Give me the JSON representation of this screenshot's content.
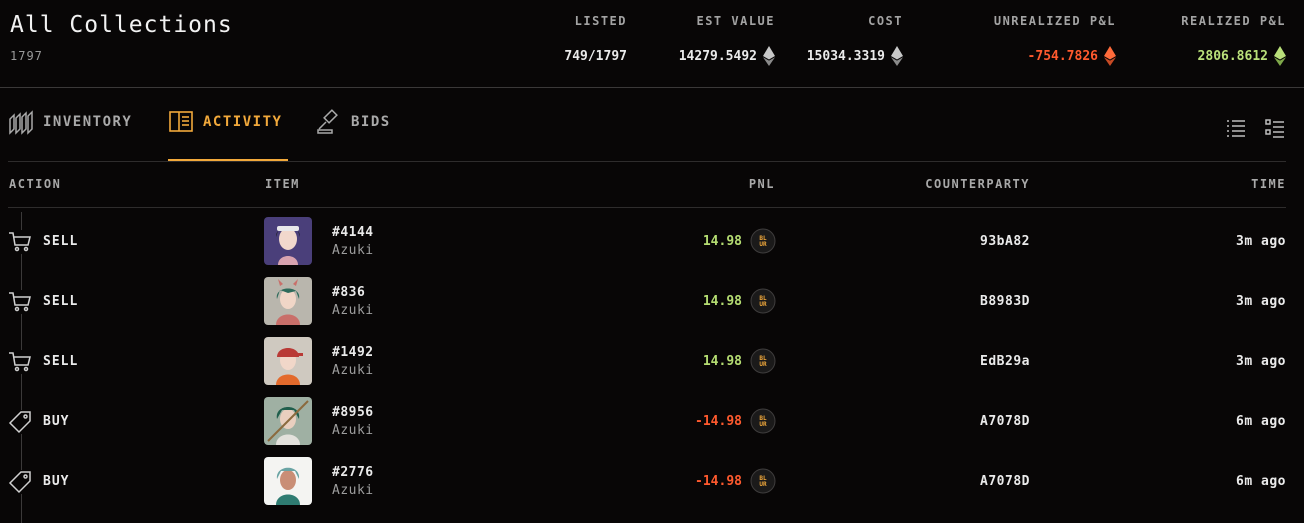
{
  "header": {
    "title": "All Collections",
    "count": "1797",
    "stats": {
      "listed": {
        "label": "LISTED",
        "value": "749/1797"
      },
      "est_value": {
        "label": "EST VALUE",
        "value": "14279.5492"
      },
      "cost": {
        "label": "COST",
        "value": "15034.3319"
      },
      "unrealized": {
        "label": "UNREALIZED P&L",
        "value": "-754.7826",
        "color": "#ff5a2e"
      },
      "realized": {
        "label": "REALIZED P&L",
        "value": "2806.8612",
        "color": "#b9e07a"
      }
    }
  },
  "tabs": [
    {
      "label": "INVENTORY",
      "icon": "inventory-icon",
      "active": false
    },
    {
      "label": "ACTIVITY",
      "icon": "book-icon",
      "active": true
    },
    {
      "label": "BIDS",
      "icon": "gavel-icon",
      "active": false
    }
  ],
  "view_icons": [
    "list-view-icon",
    "detail-list-view-icon"
  ],
  "columns": {
    "action": "ACTION",
    "item": "ITEM",
    "pnl": "PNL",
    "counterparty": "COUNTERPARTY",
    "time": "TIME"
  },
  "rows": [
    {
      "action": "SELL",
      "action_icon": "cart-icon",
      "item_id": "#4144",
      "collection": "Azuki",
      "pnl": "14.98",
      "pnl_sign": "pos",
      "counterparty": "93bA82",
      "time": "3m ago"
    },
    {
      "action": "SELL",
      "action_icon": "cart-icon",
      "item_id": "#836",
      "collection": "Azuki",
      "pnl": "14.98",
      "pnl_sign": "pos",
      "counterparty": "B8983D",
      "time": "3m ago"
    },
    {
      "action": "SELL",
      "action_icon": "cart-icon",
      "item_id": "#1492",
      "collection": "Azuki",
      "pnl": "14.98",
      "pnl_sign": "pos",
      "counterparty": "EdB29a",
      "time": "3m ago"
    },
    {
      "action": "BUY",
      "action_icon": "tag-icon",
      "item_id": "#8956",
      "collection": "Azuki",
      "pnl": "-14.98",
      "pnl_sign": "neg",
      "counterparty": "A7078D",
      "time": "6m ago"
    },
    {
      "action": "BUY",
      "action_icon": "tag-icon",
      "item_id": "#2776",
      "collection": "Azuki",
      "pnl": "-14.98",
      "pnl_sign": "neg",
      "counterparty": "A7078D",
      "time": "6m ago"
    }
  ],
  "colors": {
    "accent": "#f2a93b",
    "positive": "#b5dd72",
    "negative": "#ff5a2e",
    "background": "#080606"
  }
}
